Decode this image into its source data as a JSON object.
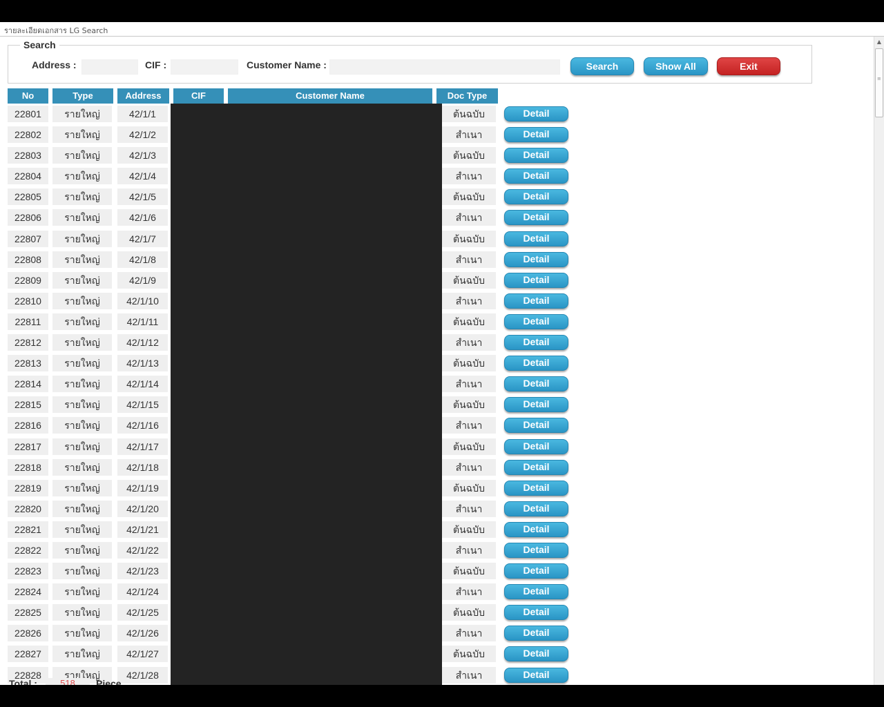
{
  "window": {
    "title": "รายละเอียดเอกสาร LG Search"
  },
  "search": {
    "legend": "Search",
    "address_label": "Address :",
    "address_value": "",
    "cif_label": "CIF :",
    "cif_value": "",
    "customer_name_label": "Customer Name :",
    "customer_name_value": "",
    "search_button": "Search",
    "show_all_button": "Show All",
    "exit_button": "Exit"
  },
  "colors": {
    "header": "#3590b8",
    "button_blue": "#2a95c5",
    "button_red": "#c42222",
    "redaction": "#232323"
  },
  "table": {
    "headers": {
      "no": "No",
      "type": "Type",
      "address": "Address",
      "cif": "CIF",
      "customer_name": "Customer Name",
      "doc_type": "Doc Type"
    },
    "detail_label": "Detail",
    "rows": [
      {
        "no": "22801",
        "type": "รายใหญ่",
        "address": "42/1/1",
        "doc_type": "ต้นฉบับ"
      },
      {
        "no": "22802",
        "type": "รายใหญ่",
        "address": "42/1/2",
        "doc_type": "สำเนา"
      },
      {
        "no": "22803",
        "type": "รายใหญ่",
        "address": "42/1/3",
        "doc_type": "ต้นฉบับ"
      },
      {
        "no": "22804",
        "type": "รายใหญ่",
        "address": "42/1/4",
        "doc_type": "สำเนา"
      },
      {
        "no": "22805",
        "type": "รายใหญ่",
        "address": "42/1/5",
        "doc_type": "ต้นฉบับ"
      },
      {
        "no": "22806",
        "type": "รายใหญ่",
        "address": "42/1/6",
        "doc_type": "สำเนา"
      },
      {
        "no": "22807",
        "type": "รายใหญ่",
        "address": "42/1/7",
        "doc_type": "ต้นฉบับ"
      },
      {
        "no": "22808",
        "type": "รายใหญ่",
        "address": "42/1/8",
        "doc_type": "สำเนา"
      },
      {
        "no": "22809",
        "type": "รายใหญ่",
        "address": "42/1/9",
        "doc_type": "ต้นฉบับ"
      },
      {
        "no": "22810",
        "type": "รายใหญ่",
        "address": "42/1/10",
        "doc_type": "สำเนา"
      },
      {
        "no": "22811",
        "type": "รายใหญ่",
        "address": "42/1/11",
        "doc_type": "ต้นฉบับ"
      },
      {
        "no": "22812",
        "type": "รายใหญ่",
        "address": "42/1/12",
        "doc_type": "สำเนา"
      },
      {
        "no": "22813",
        "type": "รายใหญ่",
        "address": "42/1/13",
        "doc_type": "ต้นฉบับ"
      },
      {
        "no": "22814",
        "type": "รายใหญ่",
        "address": "42/1/14",
        "doc_type": "สำเนา"
      },
      {
        "no": "22815",
        "type": "รายใหญ่",
        "address": "42/1/15",
        "doc_type": "ต้นฉบับ"
      },
      {
        "no": "22816",
        "type": "รายใหญ่",
        "address": "42/1/16",
        "doc_type": "สำเนา"
      },
      {
        "no": "22817",
        "type": "รายใหญ่",
        "address": "42/1/17",
        "doc_type": "ต้นฉบับ"
      },
      {
        "no": "22818",
        "type": "รายใหญ่",
        "address": "42/1/18",
        "doc_type": "สำเนา"
      },
      {
        "no": "22819",
        "type": "รายใหญ่",
        "address": "42/1/19",
        "doc_type": "ต้นฉบับ"
      },
      {
        "no": "22820",
        "type": "รายใหญ่",
        "address": "42/1/20",
        "doc_type": "สำเนา"
      },
      {
        "no": "22821",
        "type": "รายใหญ่",
        "address": "42/1/21",
        "doc_type": "ต้นฉบับ"
      },
      {
        "no": "22822",
        "type": "รายใหญ่",
        "address": "42/1/22",
        "doc_type": "สำเนา"
      },
      {
        "no": "22823",
        "type": "รายใหญ่",
        "address": "42/1/23",
        "doc_type": "ต้นฉบับ"
      },
      {
        "no": "22824",
        "type": "รายใหญ่",
        "address": "42/1/24",
        "doc_type": "สำเนา"
      },
      {
        "no": "22825",
        "type": "รายใหญ่",
        "address": "42/1/25",
        "doc_type": "ต้นฉบับ"
      },
      {
        "no": "22826",
        "type": "รายใหญ่",
        "address": "42/1/26",
        "doc_type": "สำเนา"
      },
      {
        "no": "22827",
        "type": "รายใหญ่",
        "address": "42/1/27",
        "doc_type": "ต้นฉบับ"
      },
      {
        "no": "22828",
        "type": "รายใหญ่",
        "address": "42/1/28",
        "doc_type": "สำเนา"
      }
    ]
  },
  "footer": {
    "total_label": "Total :",
    "count": "518",
    "unit": "Piece"
  },
  "icons": {
    "scroll_up": "scroll-up-arrow-icon",
    "scroll_grip": "scroll-grip-icon"
  }
}
